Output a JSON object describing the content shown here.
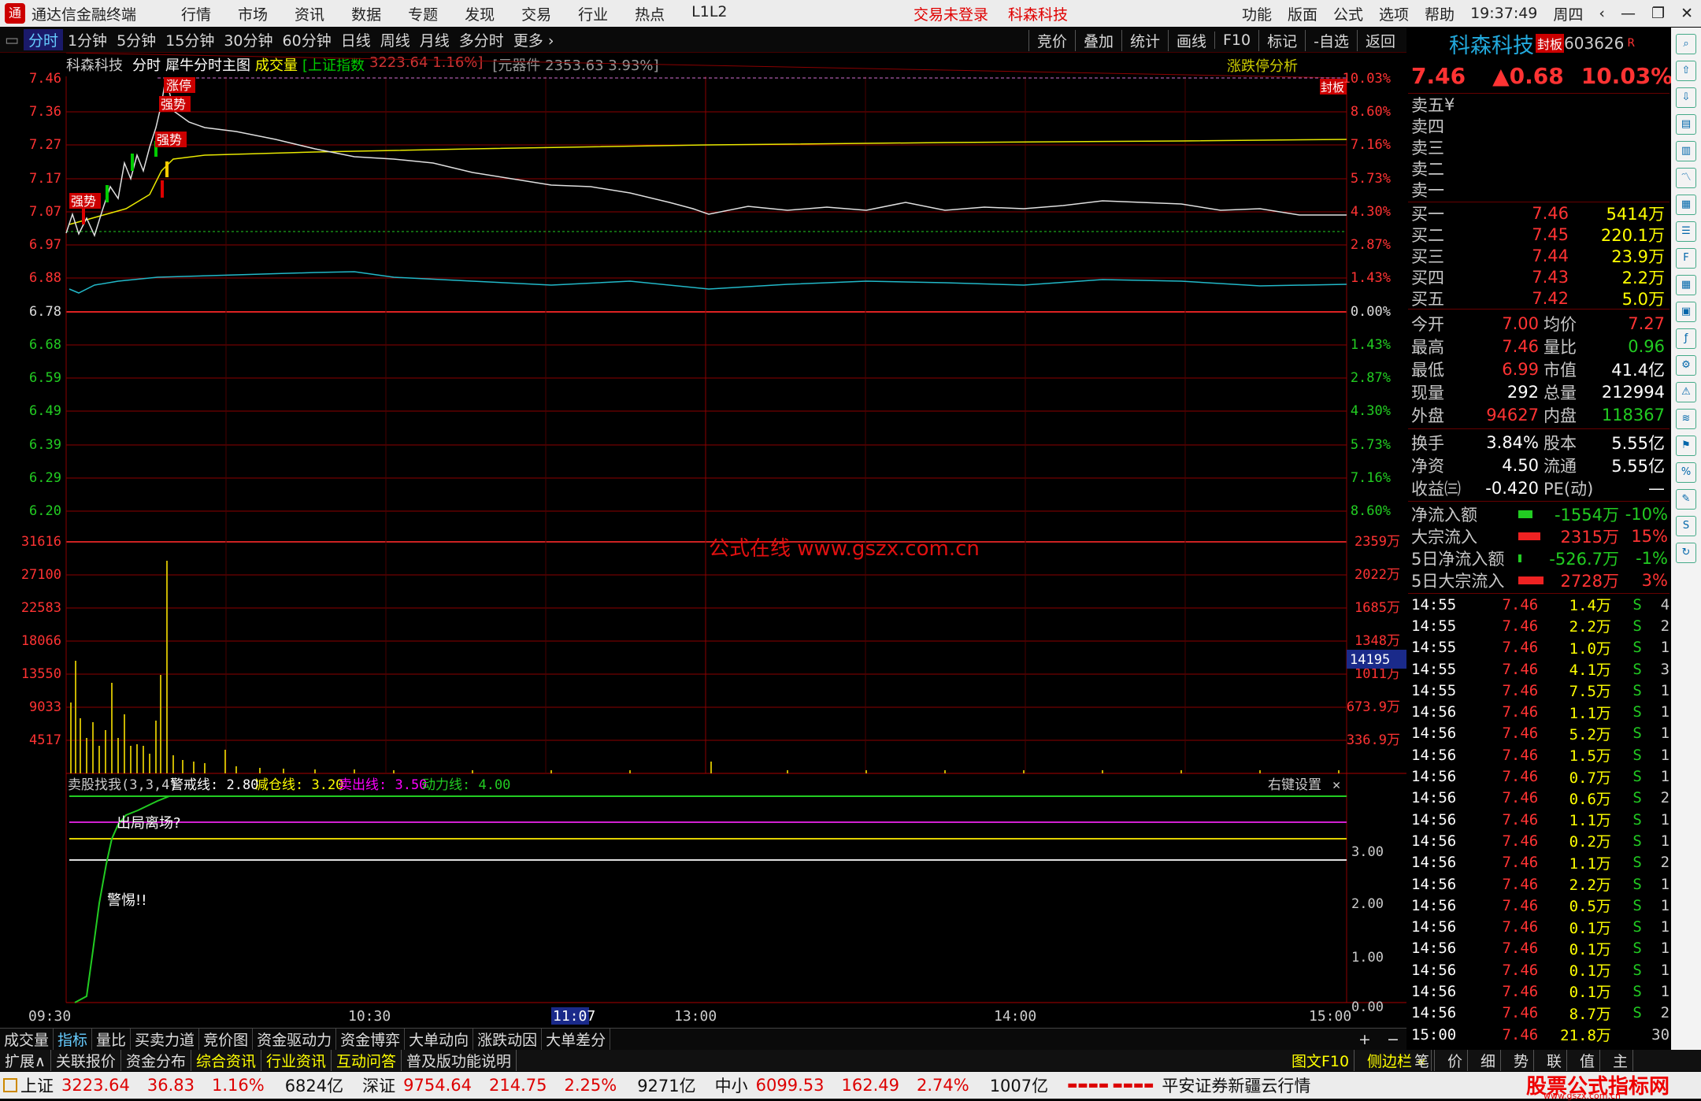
{
  "app": {
    "title": "通达信金融终端",
    "menus": [
      "行情",
      "市场",
      "资讯",
      "数据",
      "专题",
      "发现",
      "交易",
      "行业",
      "热点",
      "L1L2"
    ],
    "login": "交易未登录",
    "stock_name_top": "科森科技",
    "right_menus": [
      "功能",
      "版面",
      "公式",
      "选项",
      "帮助"
    ],
    "time": "19:37:49",
    "weekday": "周四"
  },
  "period_tabs": [
    "分时",
    "1分钟",
    "5分钟",
    "15分钟",
    "30分钟",
    "60分钟",
    "日线",
    "周线",
    "月线",
    "多分时",
    "更多 ›"
  ],
  "chart_tools": [
    "竞价",
    "叠加",
    "统计",
    "画线",
    "F10",
    "标记",
    "-自选",
    "返回"
  ],
  "chart_header": {
    "name": "科森科技",
    "mode": "分时",
    "sub": "犀牛分时主图",
    "vol": "成交量",
    "index_label": "[上证指数",
    "index_val": "3223.64 1.16%]",
    "sector": "[元器件 2353.63 3.93%]",
    "zt": "涨跌停分析",
    "fengban": "封板"
  },
  "price_axis_left": [
    "7.46",
    "7.36",
    "7.27",
    "7.17",
    "7.07",
    "6.97",
    "6.88",
    "6.78",
    "6.68",
    "6.59",
    "6.49",
    "6.39",
    "6.29",
    "6.20"
  ],
  "price_axis_right": [
    "10.03%",
    "8.60%",
    "7.16%",
    "5.73%",
    "4.30%",
    "2.87%",
    "1.43%",
    "0.00%",
    "1.43%",
    "2.87%",
    "4.30%",
    "5.73%",
    "7.16%",
    "8.60%"
  ],
  "vol_axis_left": [
    "31616",
    "27100",
    "22583",
    "18066",
    "13550",
    "9033",
    "4517"
  ],
  "vol_axis_right": [
    "2359万",
    "2022万",
    "1685万",
    "1348万",
    "1011万",
    "673.9万",
    "336.9万"
  ],
  "vol_cursor": "14195",
  "labels": {
    "zhangting": "涨停",
    "qiangshi1": "强势",
    "qiangshi2": "强势",
    "qiangshi3": "强势"
  },
  "watermark": "公式在线 www.gszx.com.cn",
  "indicator": {
    "name": "卖股找我(3,3,4)",
    "l1": "警戒线: 2.80",
    "l2": "减仓线: 3.20",
    "l3": "卖出线: 3.50",
    "l4": "动力线: 4.00",
    "settings": "右键设置",
    "t1": "出局离场?",
    "t2": "警惕!!",
    "axis": [
      "3.00",
      "2.00",
      "1.00",
      "0.00"
    ]
  },
  "time_axis": [
    "09:30",
    "10:30",
    "11:07",
    "13:00",
    "14:00",
    "15:00"
  ],
  "quote": {
    "name": "科森科技",
    "tag": "封板",
    "code": "603626",
    "r": "R",
    "price": "7.46",
    "change": "▲0.68",
    "pct": "10.03%",
    "asks": [
      "卖五",
      "卖四",
      "卖三",
      "卖二",
      "卖一"
    ],
    "yen": "¥",
    "bids": [
      [
        "买一",
        "7.46",
        "5414万"
      ],
      [
        "买二",
        "7.45",
        "220.1万"
      ],
      [
        "买三",
        "7.44",
        "23.9万"
      ],
      [
        "买四",
        "7.43",
        "2.2万"
      ],
      [
        "买五",
        "7.42",
        "5.0万"
      ]
    ],
    "stats": [
      [
        "今开",
        "7.00",
        "均价",
        "7.27"
      ],
      [
        "最高",
        "7.46",
        "量比",
        "0.96"
      ],
      [
        "最低",
        "6.99",
        "市值",
        "41.4亿"
      ],
      [
        "现量",
        "292",
        "总量",
        "212994"
      ],
      [
        "外盘",
        "94627",
        "内盘",
        "118367"
      ]
    ],
    "stats2": [
      [
        "换手",
        "3.84%",
        "股本",
        "5.55亿"
      ],
      [
        "净资",
        "4.50",
        "流通",
        "5.55亿"
      ],
      [
        "收益㈢",
        "-0.420",
        "PE(动)",
        "—"
      ]
    ],
    "flows": [
      [
        "净流入额",
        "-1554万",
        "-10%"
      ],
      [
        "大宗流入",
        "2315万",
        "15%"
      ],
      [
        "5日净流入额",
        "-526.7万",
        "-1%"
      ],
      [
        "5日大宗流入",
        "2728万",
        "3%"
      ]
    ],
    "ticks": [
      [
        "14:55",
        "7.46",
        "1.4万",
        "S",
        "4"
      ],
      [
        "14:55",
        "7.46",
        "2.2万",
        "S",
        "2"
      ],
      [
        "14:55",
        "7.46",
        "1.0万",
        "S",
        "1"
      ],
      [
        "14:55",
        "7.46",
        "4.1万",
        "S",
        "3"
      ],
      [
        "14:55",
        "7.46",
        "7.5万",
        "S",
        "1"
      ],
      [
        "14:56",
        "7.46",
        "1.1万",
        "S",
        "1"
      ],
      [
        "14:56",
        "7.46",
        "5.2万",
        "S",
        "1"
      ],
      [
        "14:56",
        "7.46",
        "1.5万",
        "S",
        "1"
      ],
      [
        "14:56",
        "7.46",
        "0.7万",
        "S",
        "1"
      ],
      [
        "14:56",
        "7.46",
        "0.6万",
        "S",
        "2"
      ],
      [
        "14:56",
        "7.46",
        "1.1万",
        "S",
        "1"
      ],
      [
        "14:56",
        "7.46",
        "0.2万",
        "S",
        "1"
      ],
      [
        "14:56",
        "7.46",
        "1.1万",
        "S",
        "2"
      ],
      [
        "14:56",
        "7.46",
        "2.2万",
        "S",
        "1"
      ],
      [
        "14:56",
        "7.46",
        "0.5万",
        "S",
        "1"
      ],
      [
        "14:56",
        "7.46",
        "0.1万",
        "S",
        "1"
      ],
      [
        "14:56",
        "7.46",
        "0.1万",
        "S",
        "1"
      ],
      [
        "14:56",
        "7.46",
        "0.1万",
        "S",
        "1"
      ],
      [
        "14:56",
        "7.46",
        "0.1万",
        "S",
        "1"
      ],
      [
        "14:56",
        "7.46",
        "8.7万",
        "S",
        "2"
      ],
      [
        "15:00",
        "7.46",
        "21.8万",
        "",
        "30"
      ]
    ]
  },
  "bottom_tabs": [
    "成交量",
    "指标",
    "量比",
    "买卖力道",
    "竞价图",
    "资金驱动力",
    "资金博弈",
    "大单动向",
    "涨跌动因",
    "大单差分"
  ],
  "info_tabs": [
    "扩展∧",
    "关联报价",
    "资金分布",
    "综合资讯",
    "行业资讯",
    "互动问答",
    "普及版功能说明"
  ],
  "info_right": [
    "图文F10",
    "侧边栏 «",
    "笔",
    "价",
    "细",
    "势",
    "联",
    "值",
    "主"
  ],
  "status": {
    "sh_name": "上证",
    "sh": "3223.64",
    "sh_chg": "36.83",
    "sh_pct": "1.16%",
    "sh_amt": "6824亿",
    "sz_name": "深证",
    "sz": "9754.64",
    "sz_chg": "214.75",
    "sz_pct": "2.25%",
    "sz_amt": "9271亿",
    "zx_name": "中小",
    "zx": "6099.53",
    "zx_chg": "162.49",
    "zx_pct": "2.74%",
    "zx_amt": "1007亿",
    "broker": "平安证券新疆云行情",
    "brand": "股票公式指标网",
    "brand_url": "www.gszx.com.cn"
  }
}
